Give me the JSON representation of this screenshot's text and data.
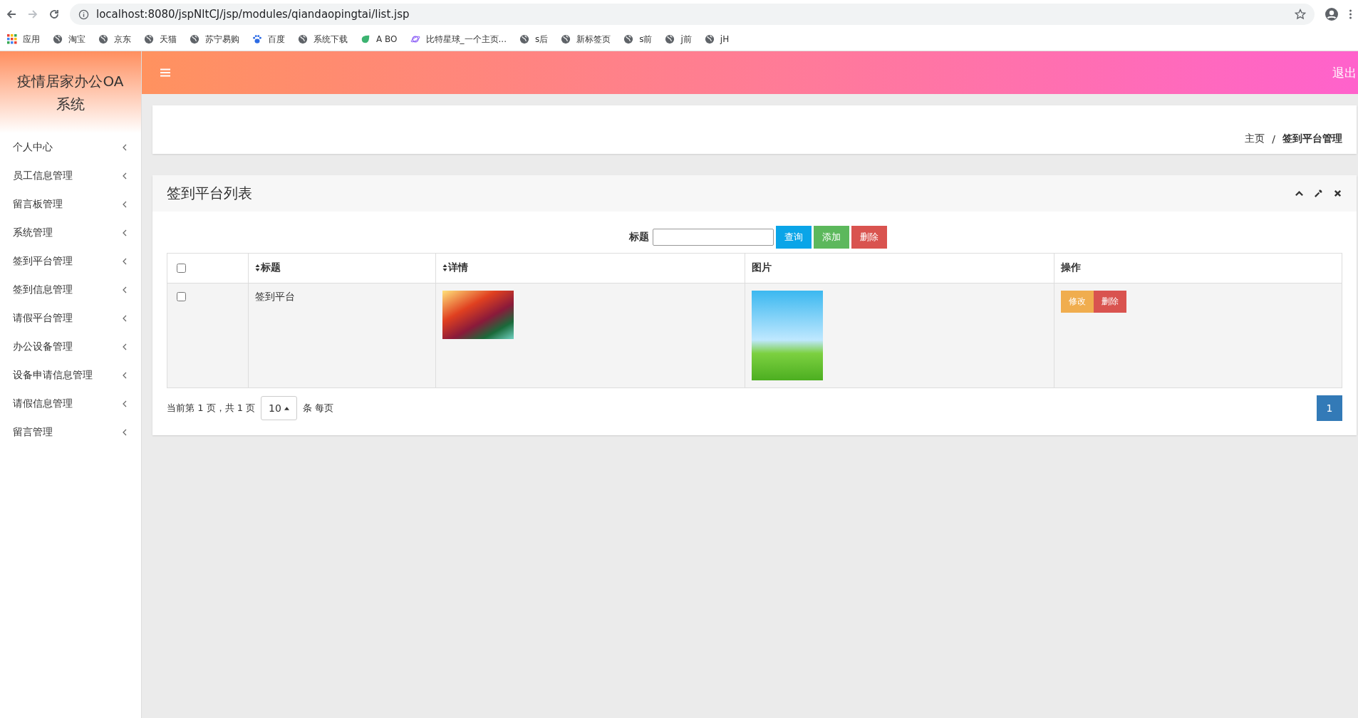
{
  "browser": {
    "url": "localhost:8080/jspNltCJ/jsp/modules/qiandaopingtai/list.jsp",
    "bookmarks": [
      {
        "label": "应用",
        "kind": "apps"
      },
      {
        "label": "淘宝",
        "kind": "globe"
      },
      {
        "label": "京东",
        "kind": "globe"
      },
      {
        "label": "天猫",
        "kind": "globe"
      },
      {
        "label": "苏宁易购",
        "kind": "globe"
      },
      {
        "label": "百度",
        "kind": "paw"
      },
      {
        "label": "系统下载",
        "kind": "globe"
      },
      {
        "label": "A BO",
        "kind": "leaf"
      },
      {
        "label": "比特星球_一个主页...",
        "kind": "planet"
      },
      {
        "label": "s后",
        "kind": "globe"
      },
      {
        "label": "新标签页",
        "kind": "globe"
      },
      {
        "label": "s前",
        "kind": "globe"
      },
      {
        "label": "j前",
        "kind": "globe"
      },
      {
        "label": "jH",
        "kind": "globe"
      }
    ]
  },
  "sidebar": {
    "title": "疫情居家办公OA系统",
    "items": [
      {
        "label": "个人中心"
      },
      {
        "label": "员工信息管理"
      },
      {
        "label": "留言板管理"
      },
      {
        "label": "系统管理"
      },
      {
        "label": "签到平台管理"
      },
      {
        "label": "签到信息管理"
      },
      {
        "label": "请假平台管理"
      },
      {
        "label": "办公设备管理"
      },
      {
        "label": "设备申请信息管理"
      },
      {
        "label": "请假信息管理"
      },
      {
        "label": "留言管理"
      }
    ]
  },
  "topbar": {
    "logout": "退出"
  },
  "breadcrumb": {
    "home": "主页",
    "separator": "/",
    "current": "签到平台管理"
  },
  "panel": {
    "title": "签到平台列表",
    "search": {
      "label": "标题"
    },
    "buttons": [
      {
        "label": "查询",
        "kind": "info"
      },
      {
        "label": "添加",
        "kind": "success"
      },
      {
        "label": "删除",
        "kind": "danger"
      }
    ],
    "table": {
      "header_checked": false,
      "columns": [
        {
          "label": "标题",
          "sortable": true
        },
        {
          "label": "详情",
          "sortable": true
        },
        {
          "label": "图片",
          "sortable": false
        },
        {
          "label": "操作",
          "sortable": false
        }
      ],
      "rows": [
        {
          "checked": false,
          "title": "签到平台",
          "actions": [
            {
              "label": "修改",
              "kind": "warning"
            },
            {
              "label": "删除",
              "kind": "danger"
            }
          ]
        }
      ]
    },
    "pagination": {
      "info": "当前第 1 页，共 1 页",
      "page_size": "10",
      "suffix": "条 每页",
      "pages": [
        {
          "label": "1",
          "selected": true
        }
      ]
    }
  }
}
